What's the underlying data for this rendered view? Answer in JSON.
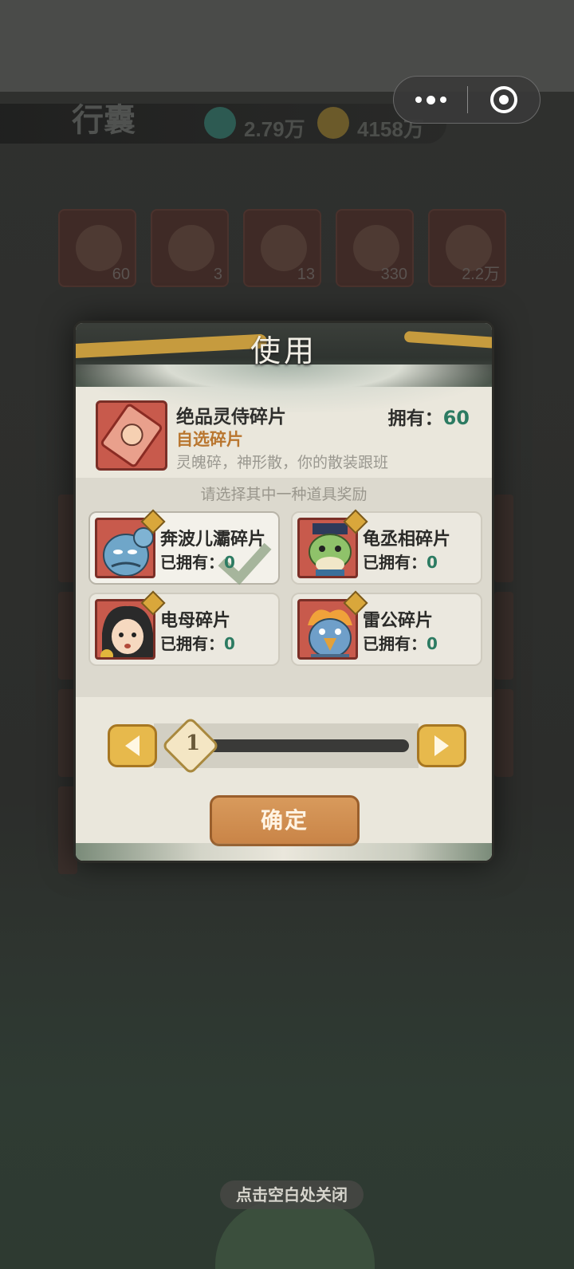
{
  "background": {
    "title": "行囊",
    "currency_1": "2.79万",
    "currency_2": "4158万",
    "item_counts": [
      "60",
      "3",
      "13",
      "330",
      "2.2万"
    ]
  },
  "capsule": {
    "more_icon": "more-dots-icon",
    "close_icon": "target-close-icon"
  },
  "dialog": {
    "title": "使用",
    "item": {
      "name": "绝品灵侍碎片",
      "type": "自选碎片",
      "description": "灵魄碎，神形散，你的散装跟班",
      "owned_label": "拥有：",
      "owned_value": "60"
    },
    "choose_label": "请选择其中一种道具奖励",
    "options": [
      {
        "name": "奔波儿灞碎片",
        "owned_label": "已拥有：",
        "owned_value": "0",
        "selected": true
      },
      {
        "name": "龟丞相碎片",
        "owned_label": "已拥有：",
        "owned_value": "0",
        "selected": false
      },
      {
        "name": "电母碎片",
        "owned_label": "已拥有：",
        "owned_value": "0",
        "selected": false
      },
      {
        "name": "雷公碎片",
        "owned_label": "已拥有：",
        "owned_value": "0",
        "selected": false
      }
    ],
    "quantity": "1",
    "confirm_label": "确定"
  },
  "close_hint": "点击空白处关闭",
  "colors": {
    "accent_gold": "#e7b94c",
    "owned_green": "#2c7b62",
    "type_orange": "#b9762f",
    "confirm_bg": "#c98447"
  }
}
